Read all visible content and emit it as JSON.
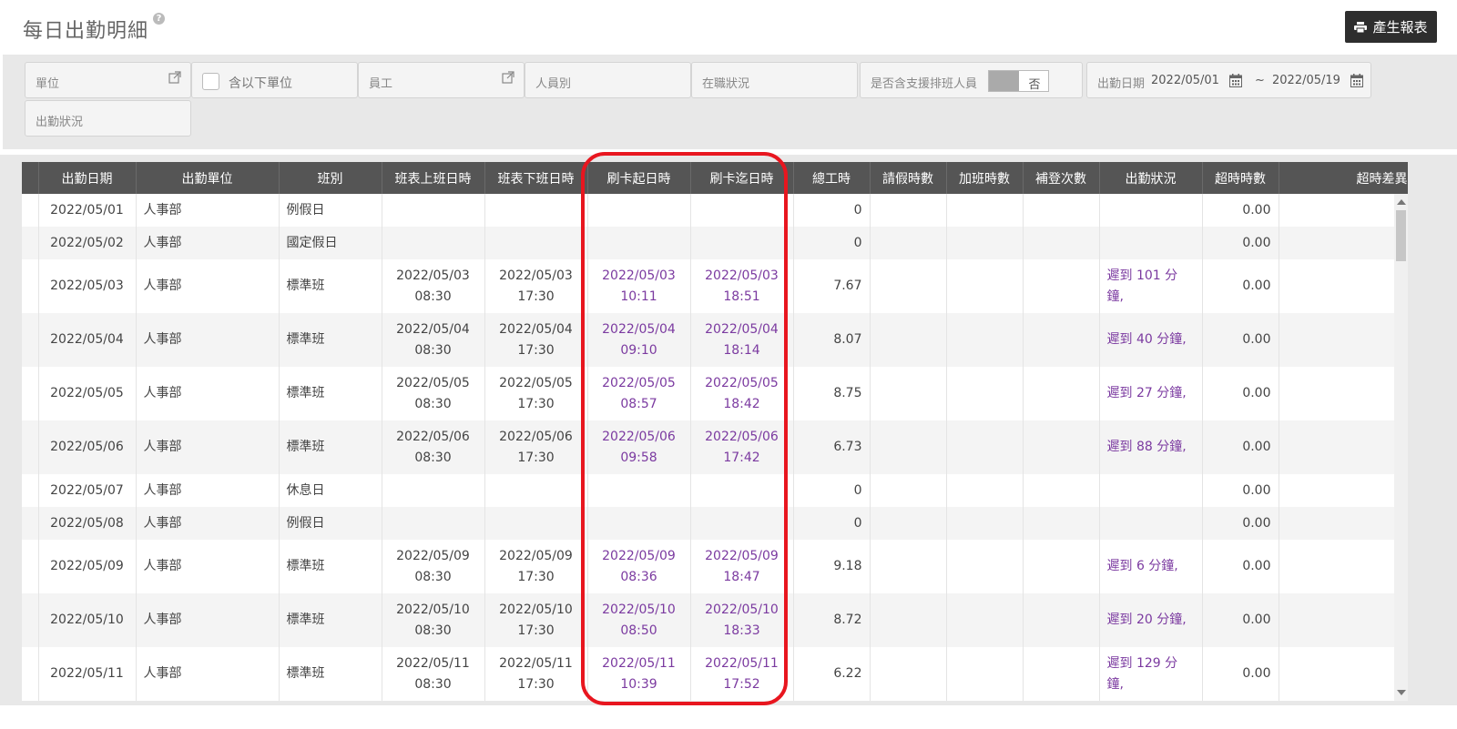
{
  "header": {
    "title": "每日出勤明細",
    "help_icon": "question-circle-icon",
    "report_label": "產生報表",
    "report_icon": "printer-icon"
  },
  "filters": {
    "unit_label": "單位",
    "include_sub_label": "含以下單位",
    "employee_label": "員工",
    "person_type_label": "人員別",
    "employment_status_label": "在職狀況",
    "support_label": "是否含支援排班人員",
    "support_value": "否",
    "date_label": "出勤日期",
    "date_from": "2022/05/01",
    "date_sep": "~",
    "date_to": "2022/05/19",
    "attendance_status_label": "出勤狀況"
  },
  "table": {
    "columns": [
      "出勤日期",
      "出勤單位",
      "班別",
      "班表上班日時",
      "班表下班日時",
      "刷卡起日時",
      "刷卡迄日時",
      "總工時",
      "請假時數",
      "加班時數",
      "補登次數",
      "出勤狀況",
      "超時時數",
      "超時差異"
    ],
    "rows": [
      {
        "date": "2022/05/01",
        "unit": "人事部",
        "shift": "例假日",
        "sched_in": "",
        "sched_out": "",
        "punch_in": "",
        "punch_out": "",
        "hours": "0",
        "leave": "",
        "overtime": "",
        "makeup": "",
        "status": "",
        "excess": "0.00"
      },
      {
        "date": "2022/05/02",
        "unit": "人事部",
        "shift": "國定假日",
        "sched_in": "",
        "sched_out": "",
        "punch_in": "",
        "punch_out": "",
        "hours": "0",
        "leave": "",
        "overtime": "",
        "makeup": "",
        "status": "",
        "excess": "0.00"
      },
      {
        "date": "2022/05/03",
        "unit": "人事部",
        "shift": "標準班",
        "sched_in": "2022/05/03 08:30",
        "sched_out": "2022/05/03 17:30",
        "punch_in": "2022/05/03 10:11",
        "punch_out": "2022/05/03 18:51",
        "hours": "7.67",
        "leave": "",
        "overtime": "",
        "makeup": "",
        "status": "遲到 101 分鐘,",
        "excess": "0.00"
      },
      {
        "date": "2022/05/04",
        "unit": "人事部",
        "shift": "標準班",
        "sched_in": "2022/05/04 08:30",
        "sched_out": "2022/05/04 17:30",
        "punch_in": "2022/05/04 09:10",
        "punch_out": "2022/05/04 18:14",
        "hours": "8.07",
        "leave": "",
        "overtime": "",
        "makeup": "",
        "status": "遲到 40 分鐘,",
        "excess": "0.00"
      },
      {
        "date": "2022/05/05",
        "unit": "人事部",
        "shift": "標準班",
        "sched_in": "2022/05/05 08:30",
        "sched_out": "2022/05/05 17:30",
        "punch_in": "2022/05/05 08:57",
        "punch_out": "2022/05/05 18:42",
        "hours": "8.75",
        "leave": "",
        "overtime": "",
        "makeup": "",
        "status": "遲到 27 分鐘,",
        "excess": "0.00"
      },
      {
        "date": "2022/05/06",
        "unit": "人事部",
        "shift": "標準班",
        "sched_in": "2022/05/06 08:30",
        "sched_out": "2022/05/06 17:30",
        "punch_in": "2022/05/06 09:58",
        "punch_out": "2022/05/06 17:42",
        "hours": "6.73",
        "leave": "",
        "overtime": "",
        "makeup": "",
        "status": "遲到 88 分鐘,",
        "excess": "0.00"
      },
      {
        "date": "2022/05/07",
        "unit": "人事部",
        "shift": "休息日",
        "sched_in": "",
        "sched_out": "",
        "punch_in": "",
        "punch_out": "",
        "hours": "0",
        "leave": "",
        "overtime": "",
        "makeup": "",
        "status": "",
        "excess": "0.00"
      },
      {
        "date": "2022/05/08",
        "unit": "人事部",
        "shift": "例假日",
        "sched_in": "",
        "sched_out": "",
        "punch_in": "",
        "punch_out": "",
        "hours": "0",
        "leave": "",
        "overtime": "",
        "makeup": "",
        "status": "",
        "excess": "0.00"
      },
      {
        "date": "2022/05/09",
        "unit": "人事部",
        "shift": "標準班",
        "sched_in": "2022/05/09 08:30",
        "sched_out": "2022/05/09 17:30",
        "punch_in": "2022/05/09 08:36",
        "punch_out": "2022/05/09 18:47",
        "hours": "9.18",
        "leave": "",
        "overtime": "",
        "makeup": "",
        "status": "遲到 6 分鐘,",
        "excess": "0.00"
      },
      {
        "date": "2022/05/10",
        "unit": "人事部",
        "shift": "標準班",
        "sched_in": "2022/05/10 08:30",
        "sched_out": "2022/05/10 17:30",
        "punch_in": "2022/05/10 08:50",
        "punch_out": "2022/05/10 18:33",
        "hours": "8.72",
        "leave": "",
        "overtime": "",
        "makeup": "",
        "status": "遲到 20 分鐘,",
        "excess": "0.00"
      },
      {
        "date": "2022/05/11",
        "unit": "人事部",
        "shift": "標準班",
        "sched_in": "2022/05/11 08:30",
        "sched_out": "2022/05/11 17:30",
        "punch_in": "2022/05/11 10:39",
        "punch_out": "2022/05/11 17:52",
        "hours": "6.22",
        "leave": "",
        "overtime": "",
        "makeup": "",
        "status": "遲到 129 分鐘,",
        "excess": "0.00"
      }
    ]
  },
  "colors": {
    "header_bg": "#555555",
    "punch_text": "#7b3aa0",
    "highlight": "#e8161f",
    "button_bg": "#2e2e2e"
  }
}
